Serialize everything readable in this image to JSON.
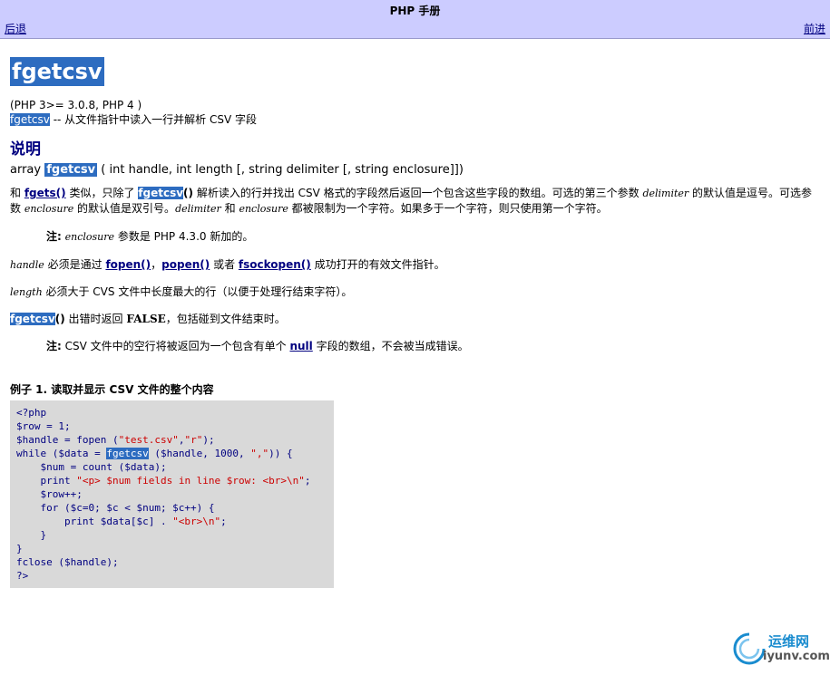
{
  "header": {
    "title": "PHP 手册",
    "prev_label": "后退",
    "next_label": "前进"
  },
  "function": {
    "name": "fgetcsv",
    "version": "(PHP 3>= 3.0.8, PHP 4 )",
    "purpose_suffix": " -- 从文件指针中读入一行并解析  CSV 字段"
  },
  "description": {
    "heading": "说明",
    "synopsis_prefix": "array ",
    "synopsis_suffix": " ( int handle, int length [, string delimiter [, string enclosure]])",
    "p1": {
      "t1": "和  ",
      "link_fgets": "fgets()",
      "t2": " 类似，只除了  ",
      "paren": "()",
      "t3": " 解析读入的行并找出  CSV 格式的字段然后返回一个包含这些字段的数组。可选的第三个参数  ",
      "param_delimiter": "delimiter",
      "t4": " 的默认值是逗号。可选参数  ",
      "param_enclosure": "enclosure",
      "t5": " 的默认值是双引号。",
      "t6": " 和  ",
      "t7": " 都被限制为一个字符。如果多于一个字符，则只使用第一个字符。"
    },
    "note1": {
      "label": "注:",
      "param": "enclosure",
      "text": " 参数是  PHP 4.3.0 新加的。"
    },
    "p_handle": {
      "param": "handle",
      "t1": " 必须是通过  ",
      "link1": "fopen()",
      "sep": "，",
      "link2": "popen()",
      "t2": " 或者  ",
      "link3": "fsockopen()",
      "t3": " 成功打开的有效文件指针。"
    },
    "p_length": {
      "param": "length",
      "text": " 必须大于  CVS 文件中长度最大的行（以便于处理行结束字符）。"
    },
    "p_return": {
      "paren": "()",
      "t1": " 出错时返回  ",
      "false": "FALSE",
      "t2": "，包括碰到文件结束时。"
    },
    "note2": {
      "label": "注:",
      "t1": " CSV 文件中的空行将被返回为一个包含有单个  ",
      "link": "null",
      "t2": " 字段的数组，不会被当成错误。"
    }
  },
  "example": {
    "title": "例子  1. 读取并显示  CSV 文件的整个内容",
    "lines": [
      "<?php",
      "$row = 1;",
      "$handle = fopen (\"test.csv\",\"r\");",
      "while ($data = fgetcsv ($handle, 1000, \",\")) {",
      "    $num = count ($data);",
      "    print \"<p> $num fields in line $row: <br>\\n\";",
      "    $row++;",
      "    for ($c=0; $c < $num; $c++) {",
      "        print $data[$c] . \"<br>\\n\";",
      "    }",
      "}",
      "fclose ($handle);",
      "?>"
    ]
  },
  "watermark": {
    "cn": "运维网",
    "en": "iyunv.com"
  },
  "colors": {
    "header_bg": "#ccccff",
    "link": "#000080",
    "highlight": "#2d6cc0",
    "code_bg": "#d9d9d9"
  }
}
